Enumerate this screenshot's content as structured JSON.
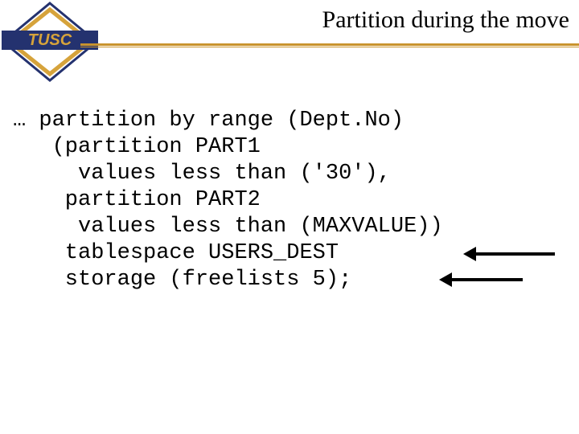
{
  "header": {
    "title": "Partition during the move",
    "logo_text": "TUSC"
  },
  "code": {
    "l1": "… partition by range (Dept.No)",
    "l2": "   (partition PART1",
    "l3": "     values less than ('30'),",
    "l4": "    partition PART2",
    "l5": "     values less than (MAXVALUE))",
    "l6": "    tablespace USERS_DEST",
    "l7": "    storage (freelists 5);"
  },
  "colors": {
    "accent": "#c9932d",
    "logo_blue": "#24326f",
    "logo_gold": "#d6a33b"
  }
}
